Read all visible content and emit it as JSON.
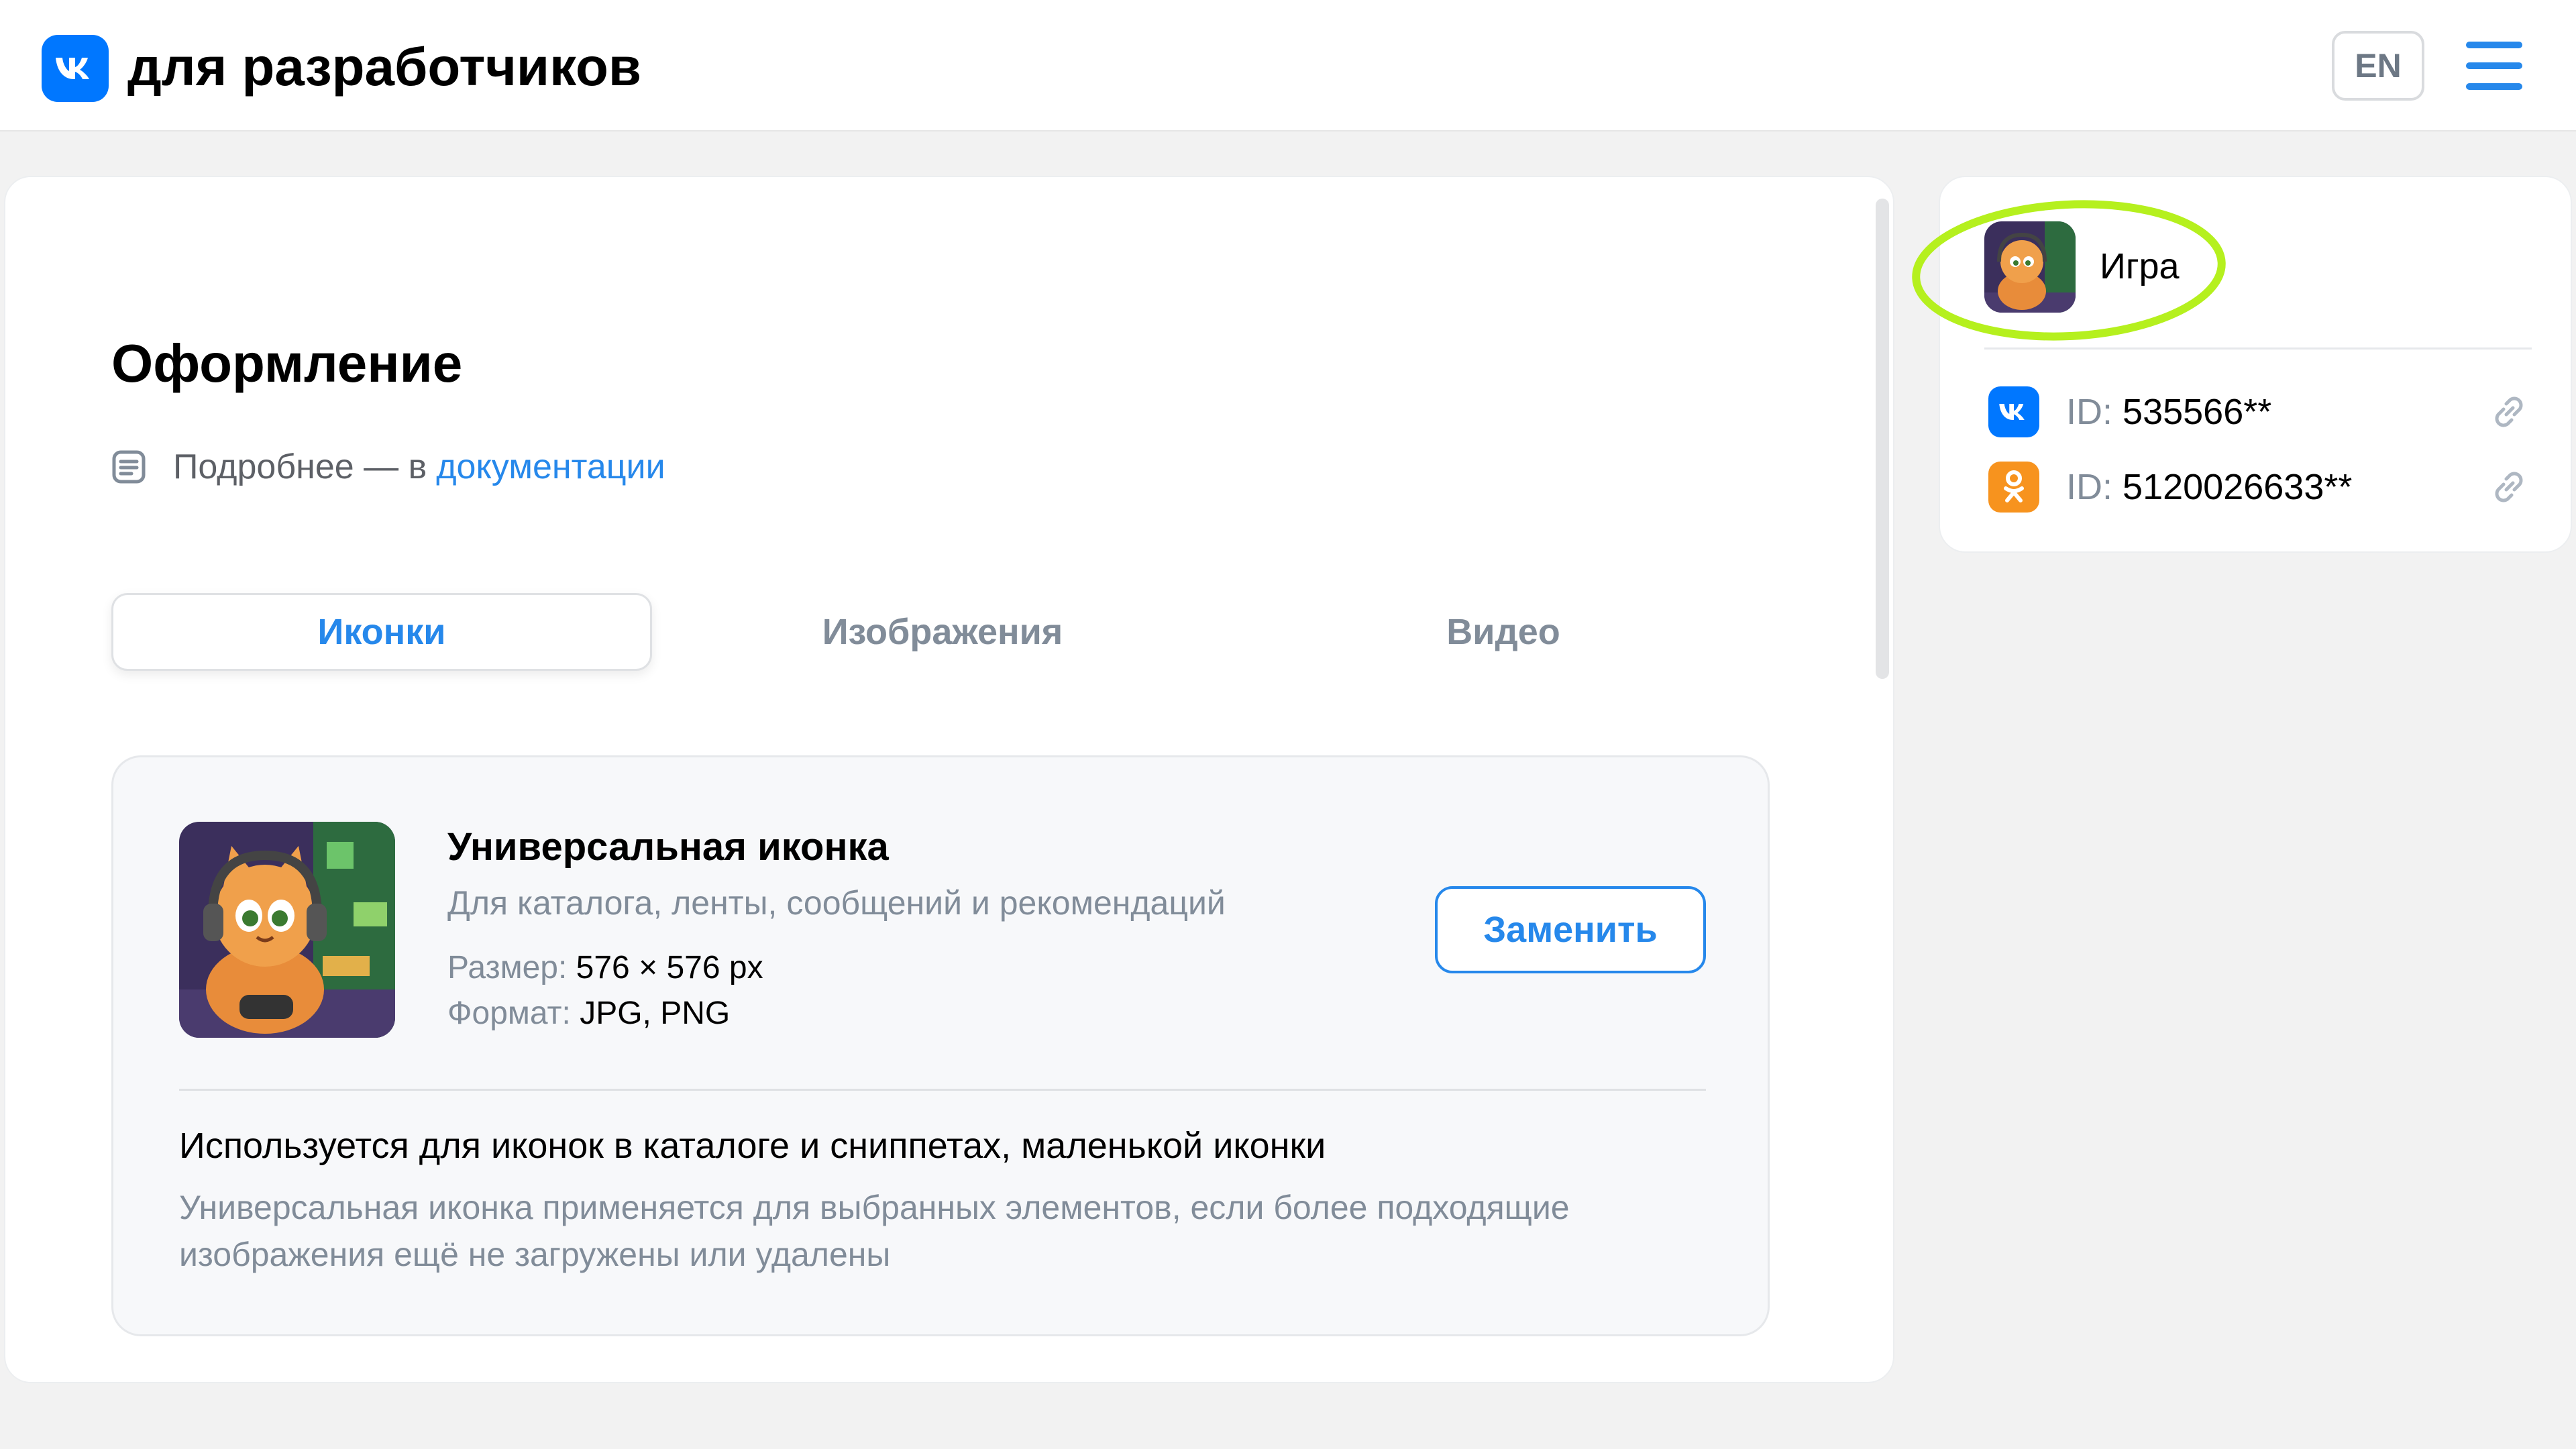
{
  "header": {
    "brand": "для разработчиков",
    "lang_button": "EN"
  },
  "page": {
    "title": "Оформление",
    "doc_prefix": "Подробнее — в",
    "doc_link": "документации"
  },
  "tabs": [
    {
      "label": "Иконки",
      "active": true
    },
    {
      "label": "Изображения",
      "active": false
    },
    {
      "label": "Видео",
      "active": false
    }
  ],
  "icon_panel": {
    "title": "Универсальная иконка",
    "subtitle": "Для каталога, ленты, сообщений и рекомендаций",
    "size_label": "Размер:",
    "size_value": "576 × 576 px",
    "format_label": "Формат:",
    "format_value": "JPG, PNG",
    "replace_button": "Заменить",
    "usage_title": "Используется для иконок в каталоге и сниппетах, маленькой иконки",
    "usage_desc_line1": "Универсальная иконка применяется для выбранных элементов, если более подходящие",
    "usage_desc_line2": "изображения ещё не загружены или удалены"
  },
  "sidebar": {
    "app_name": "Игра",
    "ids": [
      {
        "platform": "vk",
        "label": "ID:",
        "value": "535566**"
      },
      {
        "platform": "ok",
        "label": "ID:",
        "value": "5120026633**"
      }
    ]
  },
  "colors": {
    "accent": "#2688eb",
    "vk_brand": "#0077ff",
    "ok_brand": "#f7931e",
    "highlight": "#b5f01e",
    "background": "#f2f2f2"
  },
  "icons": {
    "logo": "vk-logo-icon",
    "menu": "hamburger-menu-icon",
    "doc": "document-icon",
    "link": "link-icon"
  }
}
